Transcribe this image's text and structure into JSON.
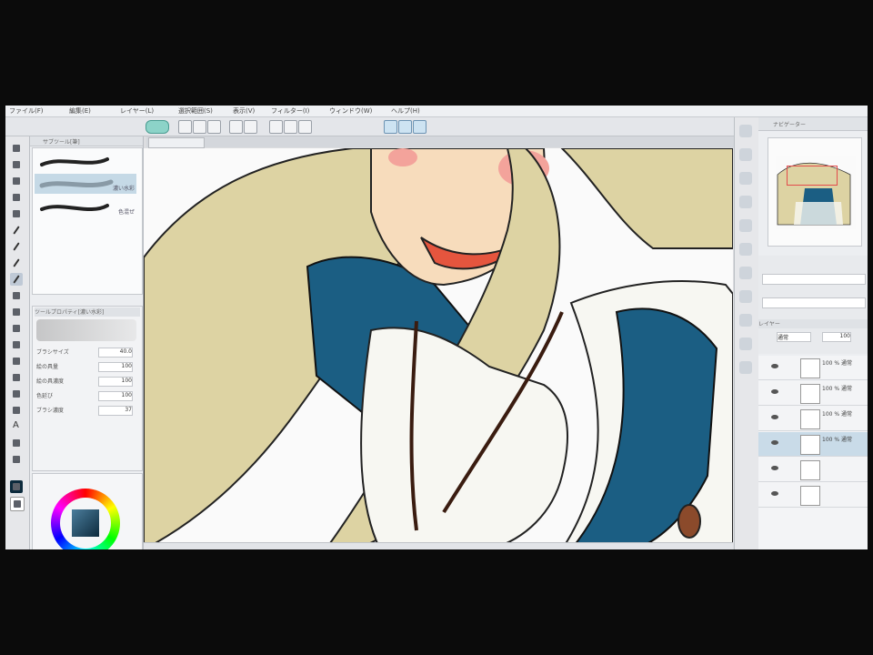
{
  "menubar": {
    "items": [
      "ファイル(F)",
      "編集(E)",
      "レイヤー(L)",
      "選択範囲(S)",
      "表示(V)",
      "フィルター(I)",
      "ウィンドウ(W)",
      "ヘルプ(H)"
    ]
  },
  "canvas_tab": {
    "label": ""
  },
  "subtool_panel": {
    "header": "サブツール[筆]",
    "brushes": [
      {
        "name": ""
      },
      {
        "name": "濃い水彩"
      },
      {
        "name": "色混ぜ"
      }
    ]
  },
  "tool_property": {
    "header": "ツールプロパティ[濃い水彩]",
    "rows": [
      {
        "label": "ブラシサイズ",
        "value": "40.0"
      },
      {
        "label": "絵の具量",
        "value": "100"
      },
      {
        "label": "絵の具濃度",
        "value": "100"
      },
      {
        "label": "色延び",
        "value": "100"
      },
      {
        "label": "ブラシ濃度",
        "value": "37"
      }
    ]
  },
  "navigator": {
    "title": "ナビゲーター"
  },
  "layers": {
    "header": "レイヤー",
    "blend_mode": "通常",
    "opacity": "100",
    "items": [
      {
        "mode": "100 % 通常"
      },
      {
        "mode": "100 % 通常"
      },
      {
        "mode": "100 % 通常"
      },
      {
        "mode": "100 % 通常"
      },
      {
        "mode": ""
      },
      {
        "mode": ""
      }
    ]
  },
  "status": {
    "zoom": ""
  },
  "colors": {
    "hair": "#ddd3a3",
    "dress": "#1b5e83",
    "apron": "#f7f7f2",
    "accent": "#8cd3c8"
  }
}
